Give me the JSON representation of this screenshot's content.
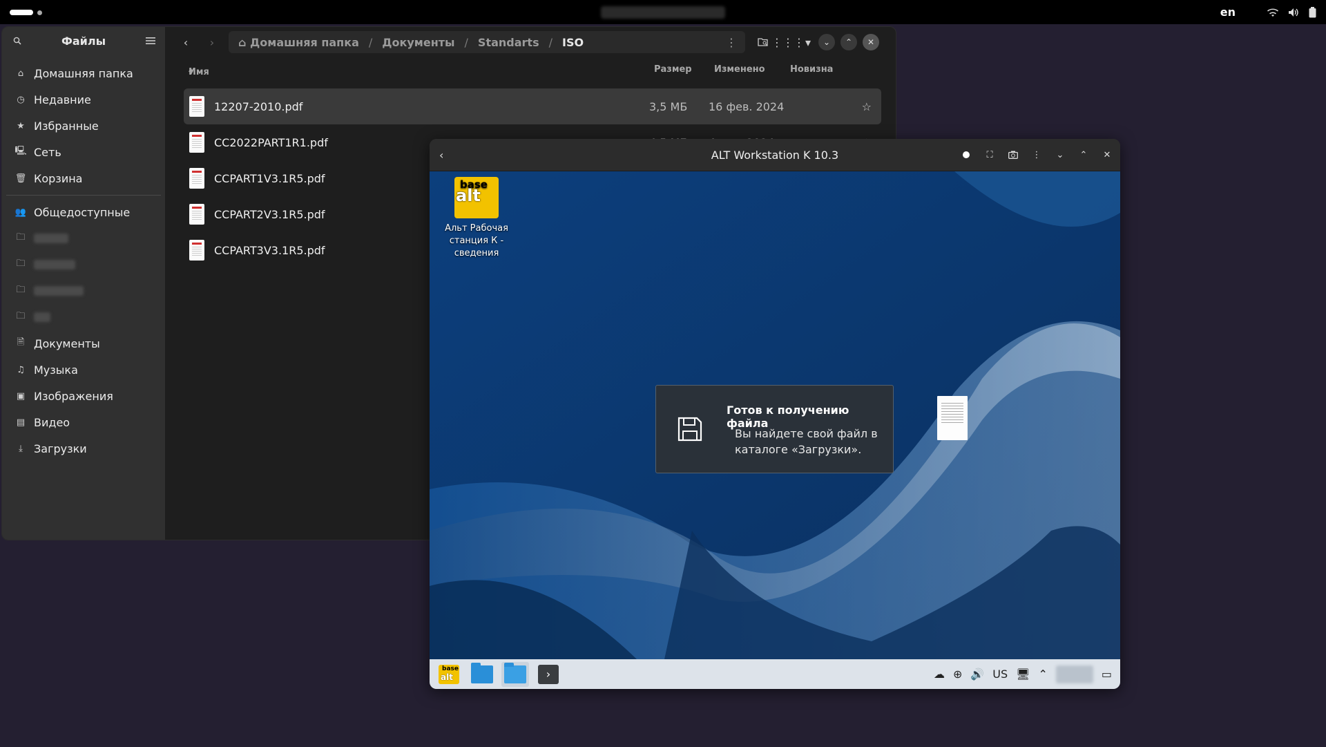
{
  "topbar": {
    "keyboard_layout": "en"
  },
  "files": {
    "sidebar": {
      "title": "Файлы",
      "items": [
        {
          "label": "Домашняя папка",
          "icon": "home-icon"
        },
        {
          "label": "Недавние",
          "icon": "clock-icon"
        },
        {
          "label": "Избранные",
          "icon": "star-icon"
        },
        {
          "label": "Сеть",
          "icon": "network-icon"
        },
        {
          "label": "Корзина",
          "icon": "trash-icon"
        }
      ],
      "bookmarks": [
        {
          "label": "Общедоступные",
          "icon": "people-icon"
        },
        {
          "label": "",
          "icon": "folder-icon"
        },
        {
          "label": "",
          "icon": "folder-icon"
        },
        {
          "label": "",
          "icon": "folder-icon"
        },
        {
          "label": "",
          "icon": "folder-icon"
        },
        {
          "label": "Документы",
          "icon": "document-icon"
        },
        {
          "label": "Музыка",
          "icon": "music-icon"
        },
        {
          "label": "Изображения",
          "icon": "image-icon"
        },
        {
          "label": "Видео",
          "icon": "video-icon"
        },
        {
          "label": "Загрузки",
          "icon": "download-icon"
        }
      ]
    },
    "path": {
      "crumbs": [
        "Домашняя папка",
        "Документы",
        "Standarts",
        "ISO"
      ]
    },
    "columns": {
      "name": "Имя",
      "size": "Размер",
      "modified": "Изменено",
      "novelty": "Новизна"
    },
    "rows": [
      {
        "name": "12207-2010.pdf",
        "size": "3,5 МБ",
        "date": "16 фев. 2024",
        "selected": true
      },
      {
        "name": "CC2022PART1R1.pdf",
        "size": "4,5 МБ",
        "date": "4 сен. 2024",
        "selected": false
      },
      {
        "name": "CCPART1V3.1R5.pdf",
        "size": "",
        "date": "",
        "selected": false
      },
      {
        "name": "CCPART2V3.1R5.pdf",
        "size": "",
        "date": "",
        "selected": false
      },
      {
        "name": "CCPART3V3.1R5.pdf",
        "size": "",
        "date": "",
        "selected": false
      }
    ]
  },
  "vm": {
    "title": "ALT Workstation K 10.3",
    "desktop_icon": {
      "logo_top": "base",
      "logo_bottom": "alt",
      "label": "Альт Рабочая станция К - сведения"
    },
    "notification": {
      "title": "Готов к получению файла",
      "message": "Вы найдете свой файл в каталоге «Загрузки»."
    },
    "taskbar": {
      "layout": "US"
    }
  },
  "colors": {
    "topbar_bg": "#000000",
    "desktop_bg": "#241f31",
    "files_sidebar": "#303030",
    "files_main": "#1e1e1e",
    "vm_desktop": "#0e3f7a",
    "alt_yellow": "#f2c200",
    "taskbar": "#dde3ea"
  }
}
